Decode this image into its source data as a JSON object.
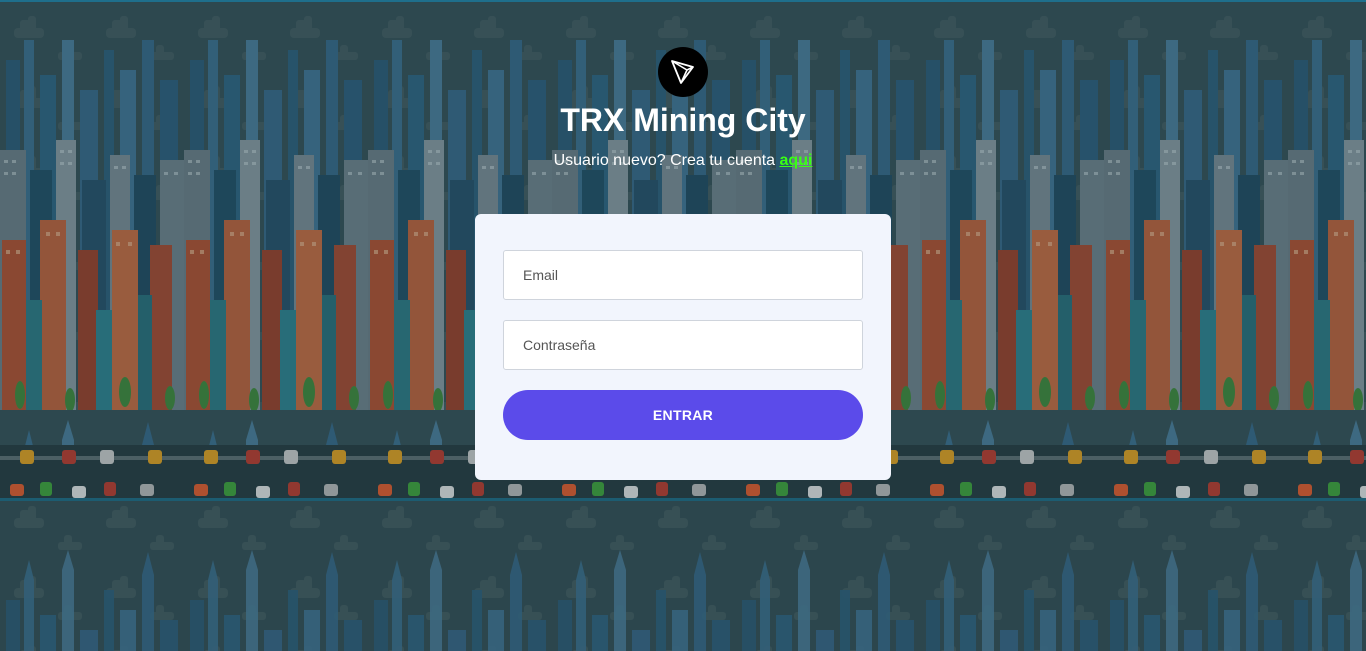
{
  "brand": {
    "title": "TRX Mining City",
    "logo_icon": "tron-logo-icon"
  },
  "signup": {
    "prompt": "Usuario nuevo? Crea tu cuenta",
    "link_label": "aqui"
  },
  "form": {
    "email_placeholder": "Email",
    "password_placeholder": "Contraseña",
    "submit_label": "ENTRAR"
  },
  "colors": {
    "accent_button": "#5b4bea",
    "link": "#39ff14",
    "card_bg": "#f2f5fd",
    "page_bg": "#2f4b53"
  }
}
